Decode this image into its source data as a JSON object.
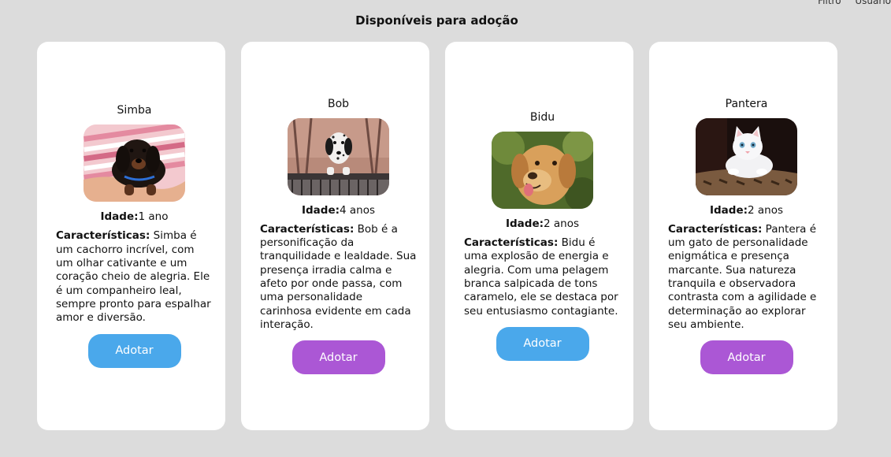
{
  "top_nav": {
    "items": [
      "Filtro",
      "Usuário"
    ]
  },
  "page": {
    "title": "Disponíveis para adoção"
  },
  "colors": {
    "button_blue": "#4aa8eb",
    "button_purple": "#ab57d5",
    "card_bg": "#ffffff",
    "page_bg": "#dcdcdc"
  },
  "pets": [
    {
      "name": "Simba",
      "photo": "dachshund-puppy-photo",
      "age_label": "Idade:",
      "age": "1 ano",
      "desc_label": "Características:",
      "desc": "Simba é um cachorro incrível, com um olhar cativante e um coração cheio de alegria. Ele é um companheiro leal, sempre pronto para espalhar amor e diversão.",
      "button": "Adotar",
      "button_color": "blue"
    },
    {
      "name": "Bob",
      "photo": "dalmatian-photo",
      "age_label": "Idade:",
      "age": "4 anos",
      "desc_label": "Características:",
      "desc": "Bob é a personificação da tranquilidade e lealdade. Sua presença irradia calma e afeto por onde passa, com uma personalidade carinhosa evidente em cada interação.",
      "button": "Adotar",
      "button_color": "purple"
    },
    {
      "name": "Bidu",
      "photo": "labrador-photo",
      "age_label": "Idade:",
      "age": "2 anos",
      "desc_label": "Características:",
      "desc": "Bidu é uma explosão de energia e alegria. Com uma pelagem branca salpicada de tons caramelo, ele se destaca por seu entusiasmo contagiante.",
      "button": "Adotar",
      "button_color": "blue"
    },
    {
      "name": "Pantera",
      "photo": "white-kitten-photo",
      "age_label": "Idade:",
      "age": "2 anos",
      "desc_label": "Características:",
      "desc": "Pantera é um gato de personalidade enigmática e presença marcante. Sua natureza tranquila e observadora contrasta com a agilidade e determinação ao explorar seu ambiente.",
      "button": "Adotar",
      "button_color": "purple"
    }
  ]
}
